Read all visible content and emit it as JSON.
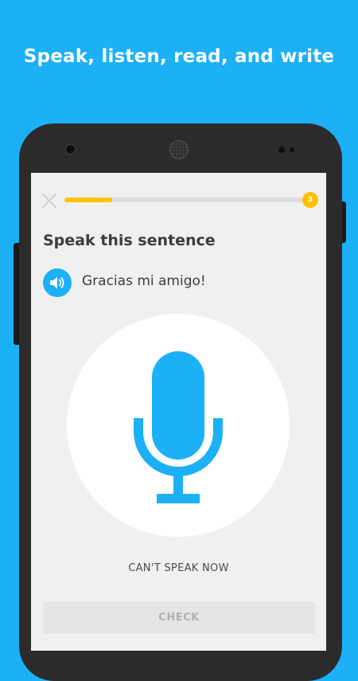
{
  "headline": "Speak, listen, read, and write",
  "lesson": {
    "progress": 0.2,
    "progress_count": "3",
    "prompt_title": "Speak this sentence",
    "sentence": "Gracias mi amigo!",
    "cant_speak_label": "CAN'T SPEAK NOW",
    "check_label": "CHECK"
  },
  "icons": {
    "close": "close-icon",
    "audio": "speaker-icon",
    "mic": "microphone-icon"
  },
  "colors": {
    "brand_blue": "#1cb0f6",
    "progress_yellow": "#ffc200",
    "disabled_gray": "#e5e5e5"
  }
}
